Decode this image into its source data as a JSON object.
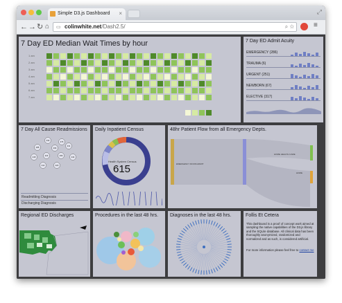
{
  "browser": {
    "tab_title": "Simple D3.js Dashboard",
    "url_host": "colinwhite.net",
    "url_path": "/Dash2.5/"
  },
  "panels": {
    "wait_times": {
      "title": "7 Day ED Median Wait Times by hour",
      "row_labels": [
        "1 am",
        "2 am",
        "3 am",
        "4 am",
        "5 am",
        "6 am",
        "7 am"
      ]
    },
    "acuity": {
      "title": "7 Day ED Admit Acuity",
      "items": [
        {
          "label": "EMERGENCY (286)"
        },
        {
          "label": "TRAUMA (6)"
        },
        {
          "label": "URGENT (251)"
        },
        {
          "label": "NEWBORN (67)"
        },
        {
          "label": "ELECTIVE (317)"
        }
      ]
    },
    "readmissions": {
      "title": "7 Day All Cause Readmissions",
      "bubbles": [
        "432",
        "476",
        "185",
        "296",
        "431",
        "423",
        "218",
        "496",
        "444",
        "214",
        "420"
      ],
      "readmitting_label": "Readmitting Diagnosis",
      "discharging_label": "Discharging Diagnosis"
    },
    "census": {
      "title": "Daily Inpatient Census",
      "center_label": "Health System Census",
      "value": "615"
    },
    "flow": {
      "title": "48hr Patient Flow from all Emergency Depts.",
      "left_node": "EMERGENCY ROOM ADMIT",
      "right_top": "HOME HEALTH CARE",
      "right_mid": "HOME"
    },
    "regional": {
      "title": "Regional ED Discharges"
    },
    "procedures": {
      "title": "Procedures in the last 48 hrs."
    },
    "diagnoses": {
      "title": "Diagnoses in the last 48 hrs."
    },
    "info": {
      "title": "Follis Et Cetera",
      "body": "This dashboard is a proof of concept work aimed at sampling the native capabilities of the D3.js library and the SQLite database. All clinical data has been thoroughly anonymized, randomized and normalized and as such, is considered artificial.",
      "contact_prefix": "For more information please feel free to",
      "contact_link": "contact me"
    }
  },
  "colors": {
    "panel_bg": "#c5c6d1",
    "frame_bg": "#3d3d3f",
    "census_ring": "#3a3f8f",
    "heat_dark": "#4f8a2a",
    "heat_mid": "#8fc45a",
    "heat_light": "#d6eaa3",
    "heat_pale": "#f4f7d6"
  }
}
